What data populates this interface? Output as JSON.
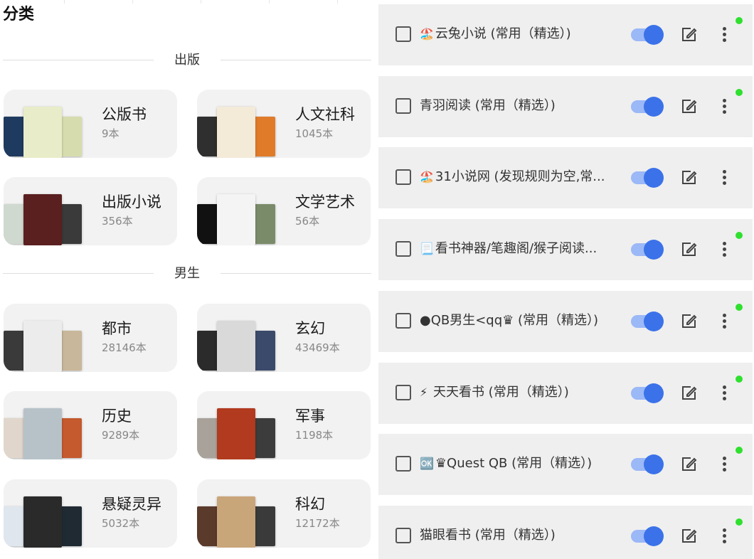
{
  "left": {
    "title": "分类",
    "sections": [
      {
        "label": "出版",
        "cards": [
          {
            "name": "公版书",
            "count": "9本",
            "covers": [
              "#1f3a5f",
              "#d7dcae",
              "#e8ecc8"
            ]
          },
          {
            "name": "人文社科",
            "count": "1045本",
            "covers": [
              "#2f2f2f",
              "#e07b2a",
              "#f3ead8"
            ]
          },
          {
            "name": "出版小说",
            "count": "356本",
            "covers": [
              "#cfd9cf",
              "#3a3a3a",
              "#5a1f1f"
            ]
          },
          {
            "name": "文学艺术",
            "count": "56本",
            "covers": [
              "#111111",
              "#7a8b6a",
              "#f4f4f4"
            ]
          }
        ]
      },
      {
        "label": "男生",
        "cards": [
          {
            "name": "都市",
            "count": "28146本",
            "covers": [
              "#3a3a3a",
              "#c8b79a",
              "#ececec"
            ]
          },
          {
            "name": "玄幻",
            "count": "43469本",
            "covers": [
              "#2b2b2b",
              "#3b4a6a",
              "#d9d9d9"
            ]
          },
          {
            "name": "历史",
            "count": "9289本",
            "covers": [
              "#e0d6cc",
              "#c45a2e",
              "#b7c2c8"
            ]
          },
          {
            "name": "军事",
            "count": "1198本",
            "covers": [
              "#a8a29a",
              "#3c3c3c",
              "#b23a1e"
            ]
          },
          {
            "name": "悬疑灵异",
            "count": "5032本",
            "covers": [
              "#dfe6ee",
              "#1f2a33",
              "#2a2a2a"
            ]
          },
          {
            "name": "科幻",
            "count": "12172本",
            "covers": [
              "#5a3a2a",
              "#3a3a3a",
              "#c9a57a"
            ]
          }
        ]
      }
    ]
  },
  "sources": [
    {
      "emoji": "🏖️",
      "name": "云兔小说 (常用（精选）)",
      "active": true
    },
    {
      "emoji": "",
      "name": "青羽阅读 (常用（精选）)",
      "active": true
    },
    {
      "emoji": "🏖️",
      "name": "31小说网 (发现规则为空,常...",
      "active": false
    },
    {
      "emoji": "📃",
      "name": "看书神器/笔趣阁/猴子阅读...",
      "active": true
    },
    {
      "emoji": "",
      "name": "●QB男生<qq♛ (常用（精选）)",
      "active": true
    },
    {
      "emoji": "⚡",
      "name": " 天天看书 (常用（精选）)",
      "active": true
    },
    {
      "emoji": "🆗",
      "name": "♛Quest QB (常用（精选）)",
      "active": true
    },
    {
      "emoji": "",
      "name": "猫眼看书 (常用（精选）)",
      "active": true
    }
  ],
  "colors": {
    "toggle_on": "#3b72ea",
    "toggle_track": "#9bb8f7",
    "status_dot": "#2fe02f",
    "card_bg": "#f2f2f2",
    "row_bg": "#efefef"
  }
}
